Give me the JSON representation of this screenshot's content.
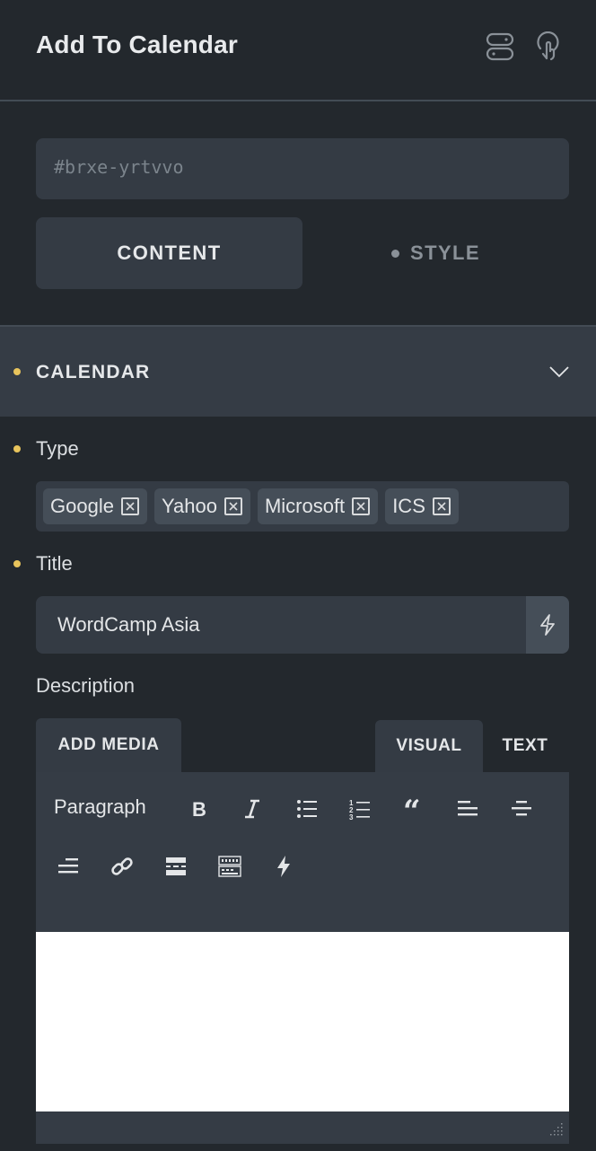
{
  "header": {
    "title": "Add To Calendar",
    "icons": [
      "structure-icon",
      "pointer-icon"
    ]
  },
  "css_id": {
    "value": "#brxe-yrtvvo"
  },
  "tabs": [
    {
      "label": "CONTENT",
      "active": true
    },
    {
      "label": "STYLE",
      "active": false,
      "indicator": "dot"
    }
  ],
  "section": {
    "title": "CALENDAR",
    "indicator_color": "#e8c45c",
    "expanded": true
  },
  "fields": {
    "type": {
      "label": "Type",
      "tags": [
        "Google",
        "Yahoo",
        "Microsoft",
        "ICS"
      ]
    },
    "title": {
      "label": "Title",
      "value": "WordCamp Asia"
    },
    "description": {
      "label": "Description",
      "add_media_label": "ADD MEDIA",
      "visual_tab_label": "VISUAL",
      "text_tab_label": "TEXT",
      "format_select": "Paragraph",
      "toolbar_icons": [
        "bold-icon",
        "italic-icon",
        "bullet-list-icon",
        "numbered-list-icon",
        "blockquote-icon",
        "align-left-icon",
        "align-center-icon",
        "align-right-icon",
        "link-icon",
        "read-more-icon",
        "toolbar-toggle-icon",
        "dynamic-data-icon"
      ],
      "content": ""
    }
  },
  "colors": {
    "background": "#23282d",
    "panel": "#343b44",
    "accent_dot": "#e8c45c"
  }
}
